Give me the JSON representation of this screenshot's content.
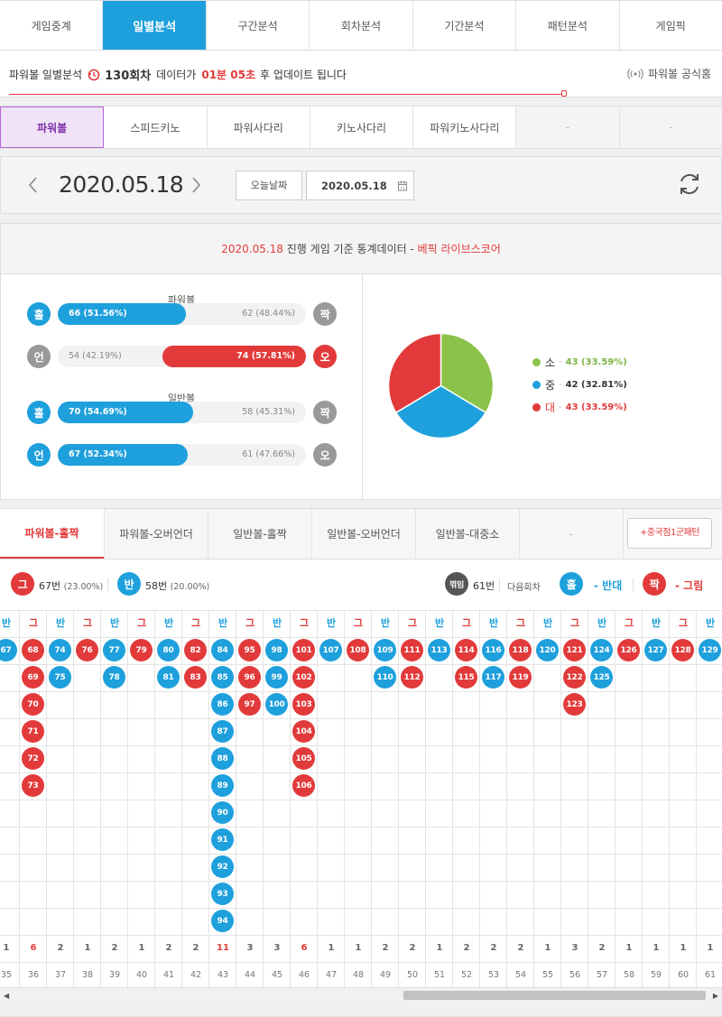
{
  "main_tabs": [
    "게임중계",
    "일별분석",
    "구간분석",
    "회차분석",
    "기간분석",
    "패턴분석",
    "게임픽"
  ],
  "info": {
    "prefix": "파워볼 일별분석",
    "round": "130회차",
    "mid": "데이터가",
    "time": "01분 05초",
    "suffix": "후 업데이트 됩니다",
    "official": "파워볼 공식홈"
  },
  "game_tabs": [
    "파워볼",
    "스피드키노",
    "파워사다리",
    "키노사다리",
    "파워키노사다리",
    "-",
    "-"
  ],
  "date": {
    "current": "2020.05.18",
    "today_btn": "오늘날짜",
    "picker": "2020.05.18"
  },
  "stats": {
    "title_date": "2020.05.18",
    "title_mid": "진행 게임 기준 통계데이터 -",
    "title_brand": "베픽 라이브스코어",
    "powerball_label": "파워볼",
    "normal_label": "일반볼",
    "rows": [
      {
        "left": "홀",
        "left_val": "66 (51.56%)",
        "left_pct": 51.56,
        "left_color": "#1ea0dc",
        "right": "짝",
        "right_val": "62 (48.44%)",
        "right_pct": 48.44,
        "right_color": "#999",
        "win": "left"
      },
      {
        "left": "언",
        "left_val": "54 (42.19%)",
        "left_pct": 42.19,
        "left_color": "#999",
        "right": "오",
        "right_val": "74 (57.81%)",
        "right_pct": 57.81,
        "right_color": "#e23a3a",
        "win": "right"
      },
      {
        "left": "홀",
        "left_val": "70 (54.69%)",
        "left_pct": 54.69,
        "left_color": "#1ea0dc",
        "right": "짝",
        "right_val": "58 (45.31%)",
        "right_pct": 45.31,
        "right_color": "#999",
        "win": "left"
      },
      {
        "left": "언",
        "left_val": "67 (52.34%)",
        "left_pct": 52.34,
        "left_color": "#1ea0dc",
        "right": "오",
        "right_val": "61 (47.66%)",
        "right_pct": 47.66,
        "right_color": "#999",
        "win": "left"
      }
    ],
    "pie": [
      {
        "label": "소",
        "value": 43,
        "text": "43 (33.59%)",
        "color": "#8bc34a"
      },
      {
        "label": "중",
        "value": 42,
        "text": "42 (32.81%)",
        "color": "#1ea0dc"
      },
      {
        "label": "대",
        "value": 43,
        "text": "43 (33.59%)",
        "color": "#e23a3a"
      }
    ]
  },
  "pattern_tabs": [
    "파워볼-홀짝",
    "파워볼-오버언더",
    "일반볼-홀짝",
    "일반볼-오버언더",
    "일반볼-대중소",
    "-"
  ],
  "pattern_btn": "+중국점1군패턴",
  "legend": {
    "g": "그",
    "g_text": "67번",
    "g_pct": "(23.00%)",
    "b": "반",
    "b_text": "58번",
    "b_pct": "(20.00%)",
    "k": "꺾임",
    "k_text": "61번",
    "next": "다음회차",
    "odd": "홀",
    "odd_text": "반대",
    "even": "짝",
    "even_text": "그림"
  },
  "grid": [
    {
      "h": "반",
      "t": "b",
      "n": [
        67
      ],
      "c": "1",
      "no": "35"
    },
    {
      "h": "그",
      "t": "r",
      "n": [
        68,
        69,
        70,
        71,
        72,
        73
      ],
      "c": "6",
      "no": "36"
    },
    {
      "h": "반",
      "t": "b",
      "n": [
        74,
        75
      ],
      "c": "2",
      "no": "37"
    },
    {
      "h": "그",
      "t": "r",
      "n": [
        76
      ],
      "c": "1",
      "no": "38"
    },
    {
      "h": "반",
      "t": "b",
      "n": [
        77,
        78
      ],
      "c": "2",
      "no": "39"
    },
    {
      "h": "그",
      "t": "r",
      "n": [
        79
      ],
      "c": "1",
      "no": "40"
    },
    {
      "h": "반",
      "t": "b",
      "n": [
        80,
        81
      ],
      "c": "2",
      "no": "41"
    },
    {
      "h": "그",
      "t": "r",
      "n": [
        82,
        83
      ],
      "c": "2",
      "no": "42"
    },
    {
      "h": "반",
      "t": "b",
      "n": [
        84,
        85,
        86,
        87,
        88,
        89,
        90,
        91,
        92,
        93,
        94
      ],
      "c": "11",
      "no": "43"
    },
    {
      "h": "그",
      "t": "r",
      "n": [
        95,
        96,
        97
      ],
      "c": "3",
      "no": "44"
    },
    {
      "h": "반",
      "t": "b",
      "n": [
        98,
        99,
        100
      ],
      "c": "3",
      "no": "45"
    },
    {
      "h": "그",
      "t": "r",
      "n": [
        101,
        102,
        103,
        104,
        105,
        106
      ],
      "c": "6",
      "no": "46"
    },
    {
      "h": "반",
      "t": "b",
      "n": [
        107
      ],
      "c": "1",
      "no": "47"
    },
    {
      "h": "그",
      "t": "r",
      "n": [
        108
      ],
      "c": "1",
      "no": "48"
    },
    {
      "h": "반",
      "t": "b",
      "n": [
        109,
        110
      ],
      "c": "2",
      "no": "49"
    },
    {
      "h": "그",
      "t": "r",
      "n": [
        111,
        112
      ],
      "c": "2",
      "no": "50"
    },
    {
      "h": "반",
      "t": "b",
      "n": [
        113
      ],
      "c": "1",
      "no": "51"
    },
    {
      "h": "그",
      "t": "r",
      "n": [
        114,
        115
      ],
      "c": "2",
      "no": "52"
    },
    {
      "h": "반",
      "t": "b",
      "n": [
        116,
        117
      ],
      "c": "2",
      "no": "53"
    },
    {
      "h": "그",
      "t": "r",
      "n": [
        118,
        119
      ],
      "c": "2",
      "no": "54"
    },
    {
      "h": "반",
      "t": "b",
      "n": [
        120
      ],
      "c": "1",
      "no": "55"
    },
    {
      "h": "그",
      "t": "r",
      "n": [
        121,
        122,
        123
      ],
      "c": "3",
      "no": "56"
    },
    {
      "h": "반",
      "t": "b",
      "n": [
        124,
        125
      ],
      "c": "2",
      "no": "57"
    },
    {
      "h": "그",
      "t": "r",
      "n": [
        126
      ],
      "c": "1",
      "no": "58"
    },
    {
      "h": "반",
      "t": "b",
      "n": [
        127
      ],
      "c": "1",
      "no": "59"
    },
    {
      "h": "그",
      "t": "r",
      "n": [
        128
      ],
      "c": "1",
      "no": "60"
    },
    {
      "h": "반",
      "t": "b",
      "n": [
        129
      ],
      "c": "1",
      "no": "61"
    }
  ]
}
